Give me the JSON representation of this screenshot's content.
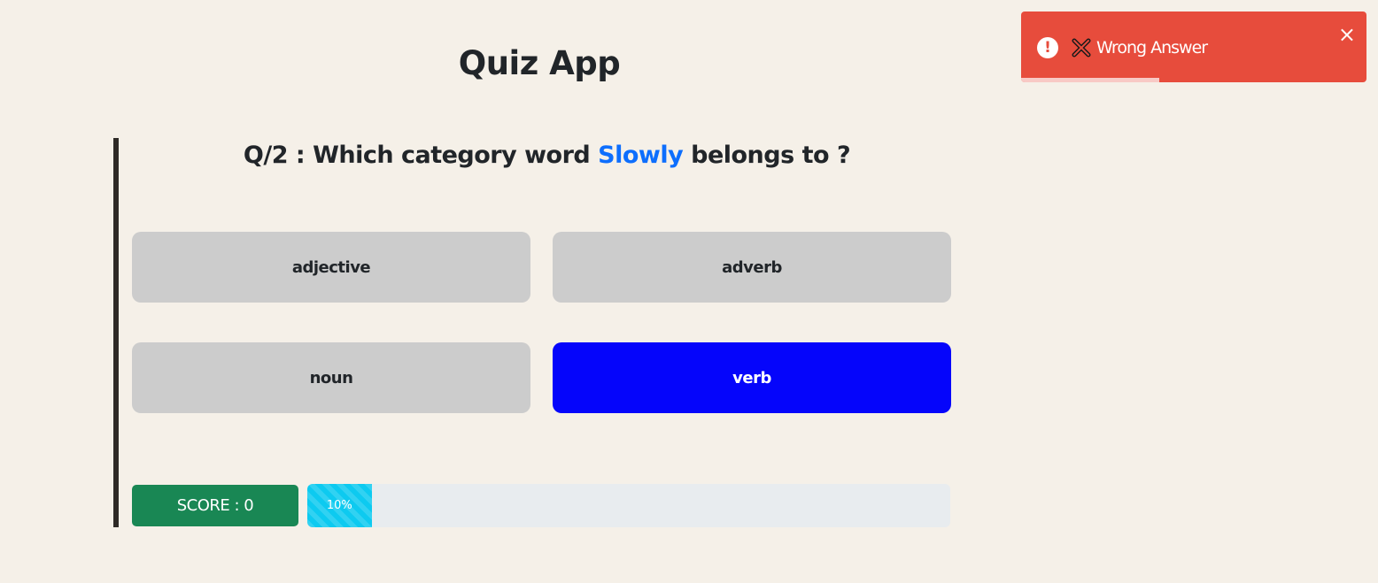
{
  "app": {
    "title": "Quiz App"
  },
  "question": {
    "prefix": "Q/2 : Which category word ",
    "highlight_word": "Slowly",
    "suffix": " belongs to ?"
  },
  "options": [
    {
      "label": "adjective",
      "selected": false
    },
    {
      "label": "adverb",
      "selected": false
    },
    {
      "label": "noun",
      "selected": false
    },
    {
      "label": "verb",
      "selected": true
    }
  ],
  "score": {
    "label": "SCORE : 0"
  },
  "progress": {
    "value": 0.1,
    "label": "10%"
  },
  "toast": {
    "message": "Wrong Answer",
    "alert_icon": "exclamation-circle-icon",
    "status_icon": "cross-mark-icon",
    "close_symbol": "×",
    "background": "#e74c3c"
  },
  "colors": {
    "background": "#f5f0e8",
    "option_default": "#cccccc",
    "option_selected": "#0505fb",
    "highlight": "#0d6efd",
    "score": "#198754",
    "progress_fill": "#0dcaf0"
  }
}
